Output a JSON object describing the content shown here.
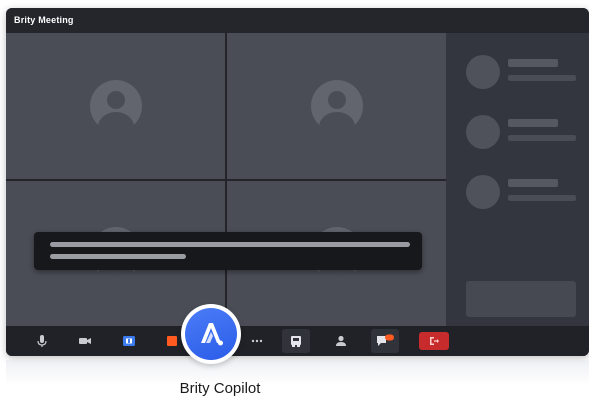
{
  "window": {
    "title": "Brity Meeting"
  },
  "copilot": {
    "label": "Brity Copilot"
  },
  "toolbar": {
    "items": [
      "mic-icon",
      "camera-icon",
      "share-screen-icon",
      "record-icon",
      "more-icon",
      "layout-icon",
      "participants-icon",
      "chat-icon",
      "leave-icon"
    ]
  },
  "colors": {
    "accent": "#3563ef",
    "leave": "#c72b2b",
    "record": "#ff5a1f",
    "background": "#3a3d45"
  }
}
